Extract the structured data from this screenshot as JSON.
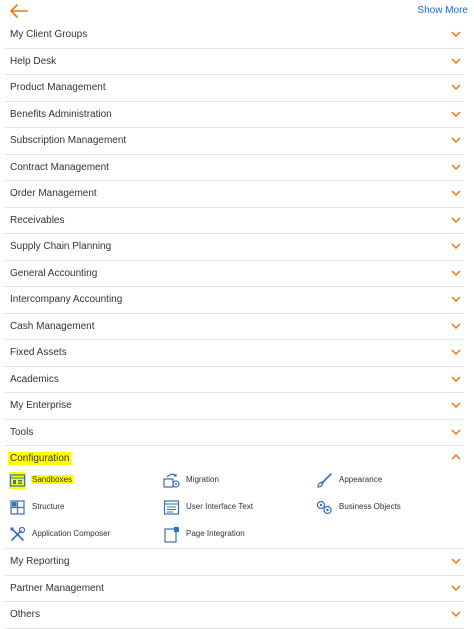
{
  "header": {
    "back_icon": "arrow-left-icon",
    "show_more": "Show More"
  },
  "colors": {
    "accent": "#e8761a",
    "link": "#1f6fbf",
    "highlight": "#ffff00",
    "icon": "#3a6fb0"
  },
  "groups_before": [
    "My Client Groups",
    "Help Desk",
    "Product Management",
    "Benefits Administration",
    "Subscription Management",
    "Contract Management",
    "Order Management",
    "Receivables",
    "Supply Chain Planning",
    "General Accounting",
    "Intercompany Accounting",
    "Cash Management",
    "Fixed Assets",
    "Academics",
    "My Enterprise",
    "Tools"
  ],
  "configuration": {
    "label": "Configuration",
    "expanded": true,
    "items": [
      {
        "label": "Sandboxes",
        "icon": "sandbox-icon",
        "highlighted": true
      },
      {
        "label": "Migration",
        "icon": "migration-icon"
      },
      {
        "label": "Appearance",
        "icon": "brush-icon"
      },
      {
        "label": "Structure",
        "icon": "structure-icon"
      },
      {
        "label": "User Interface Text",
        "icon": "ui-text-icon"
      },
      {
        "label": "Business Objects",
        "icon": "business-objects-icon"
      },
      {
        "label": "Application Composer",
        "icon": "tools-icon"
      },
      {
        "label": "Page Integration",
        "icon": "page-integration-icon"
      }
    ]
  },
  "groups_after": [
    "My Reporting",
    "Partner Management",
    "Others"
  ]
}
